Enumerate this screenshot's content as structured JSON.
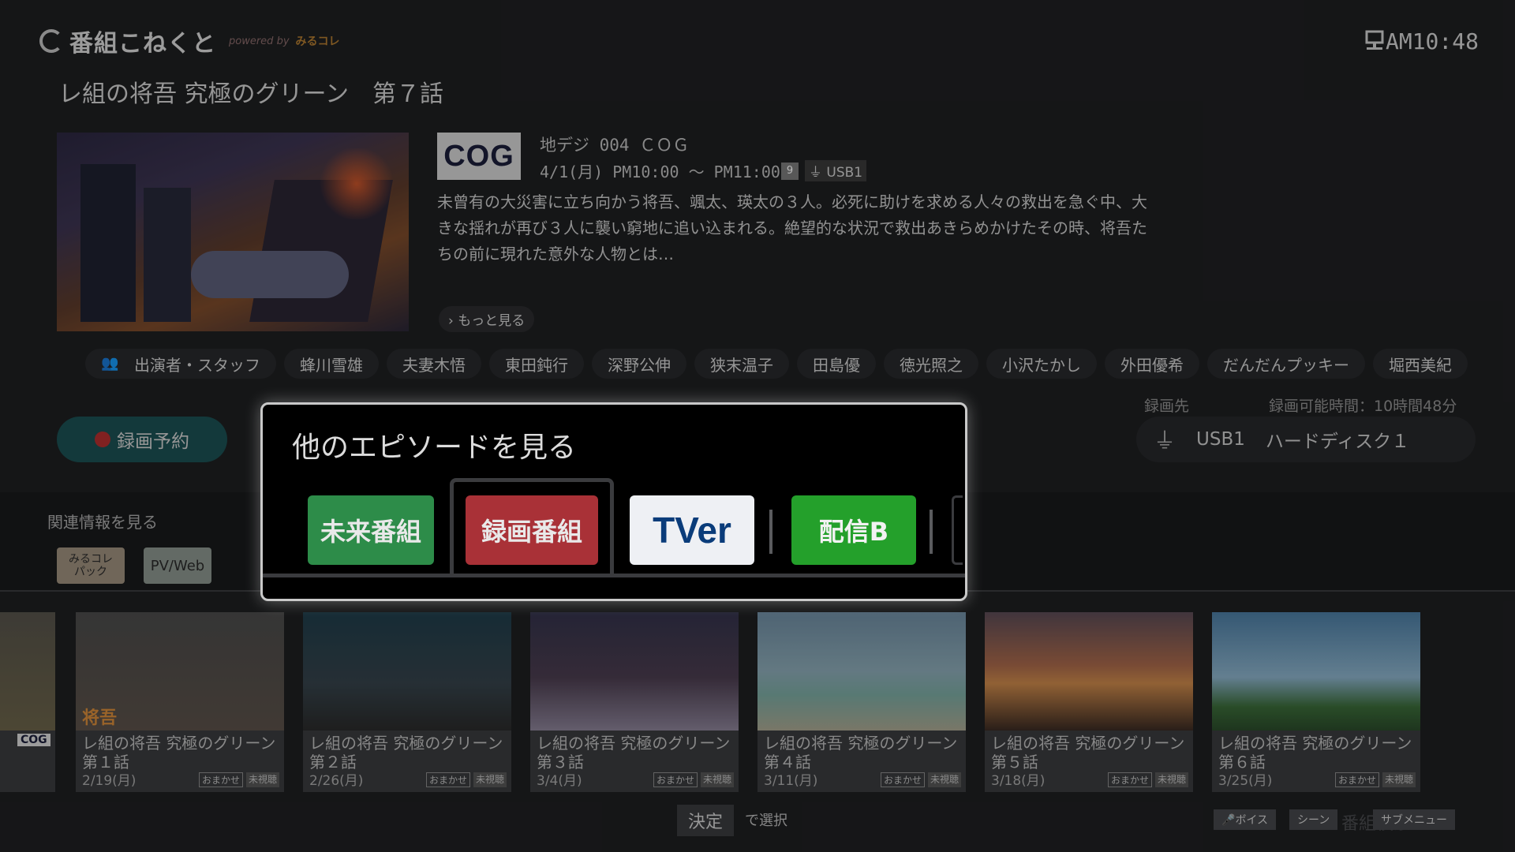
{
  "header": {
    "logo_text": "番組こねくと",
    "powered": "powered by",
    "miru_brand": "みるコレ",
    "clock": "AM10:48"
  },
  "program": {
    "title": "レ組の将吾 究極のグリーン　第７話",
    "channel_logo": "COG",
    "channel": "地デジ 004 ＣＯＧ",
    "time": "4/1(月) PM10:00 〜 PM11:00",
    "badge_num": "9",
    "badge_usb": "USB1",
    "description": "未曾有の大災害に立ち向かう将吾、颯太、瑛太の３人。必死に助けを求める人々の救出を急ぐ中、大きな揺れが再び３人に襲い窮地に追い込まれる。絶望的な状況で救出あきらめかけたその時、将吾たちの前に現れた意外な人物とは…",
    "more": "もっと見る"
  },
  "cast": {
    "label": "出演者・スタッフ",
    "names": [
      "蜂川雪雄",
      "夫妻木悟",
      "東田鈍行",
      "深野公伸",
      "狭末温子",
      "田島優",
      "徳光照之",
      "小沢たかし",
      "外田優希",
      "だんだんプッキー",
      "堀西美紀"
    ]
  },
  "record": {
    "reserve_label": "録画予約",
    "dest_label": "録画先",
    "dest_time": "録画可能時間：10時間48分",
    "dest_usb": "USB1",
    "dest_disk": "ハードディスク１"
  },
  "related": {
    "label": "関連情報を見る",
    "miru_pack_top": "みるコレ",
    "miru_pack_bottom": "パック",
    "pvweb": "PV/Web"
  },
  "dialog": {
    "title": "他のエピソードを見る",
    "services": [
      "未来番組",
      "録画番組",
      "TVer",
      "配信B"
    ]
  },
  "episodes": [
    {
      "title": "レ組の将吾 究極のグリーン　第１話",
      "date": "2/19(月)",
      "tag1": "おまかせ",
      "tag2": "未視聴",
      "badge": "将吾"
    },
    {
      "title": "レ組の将吾 究極のグリーン　第２話",
      "date": "2/26(月)",
      "tag1": "おまかせ",
      "tag2": "未視聴"
    },
    {
      "title": "レ組の将吾 究極のグリーン　第３話",
      "date": "3/4(月)",
      "tag1": "おまかせ",
      "tag2": "未視聴"
    },
    {
      "title": "レ組の将吾 究極のグリーン　第４話",
      "date": "3/11(月)",
      "tag1": "おまかせ",
      "tag2": "未視聴"
    },
    {
      "title": "レ組の将吾 究極のグリーン　第５話",
      "date": "3/18(月)",
      "tag1": "おまかせ",
      "tag2": "未視聴"
    },
    {
      "title": "レ組の将吾 究極のグリーン　第６話",
      "date": "3/25(月)",
      "tag1": "おまかせ",
      "tag2": "未視聴"
    }
  ],
  "episode_stub": {
    "logo": "COG"
  },
  "footer": {
    "ok": "決定",
    "ok_text": "で選択",
    "voice": "ボイス",
    "scene": "シーン",
    "submenu": "サブメニュー",
    "search_ghost": "番組検索"
  },
  "colors": {
    "future": "#2d8c49",
    "recorded": "#a93137",
    "tver_bg": "#eef0f4",
    "haishin_b": "#24a02b",
    "reserve": "#1b4f52"
  }
}
